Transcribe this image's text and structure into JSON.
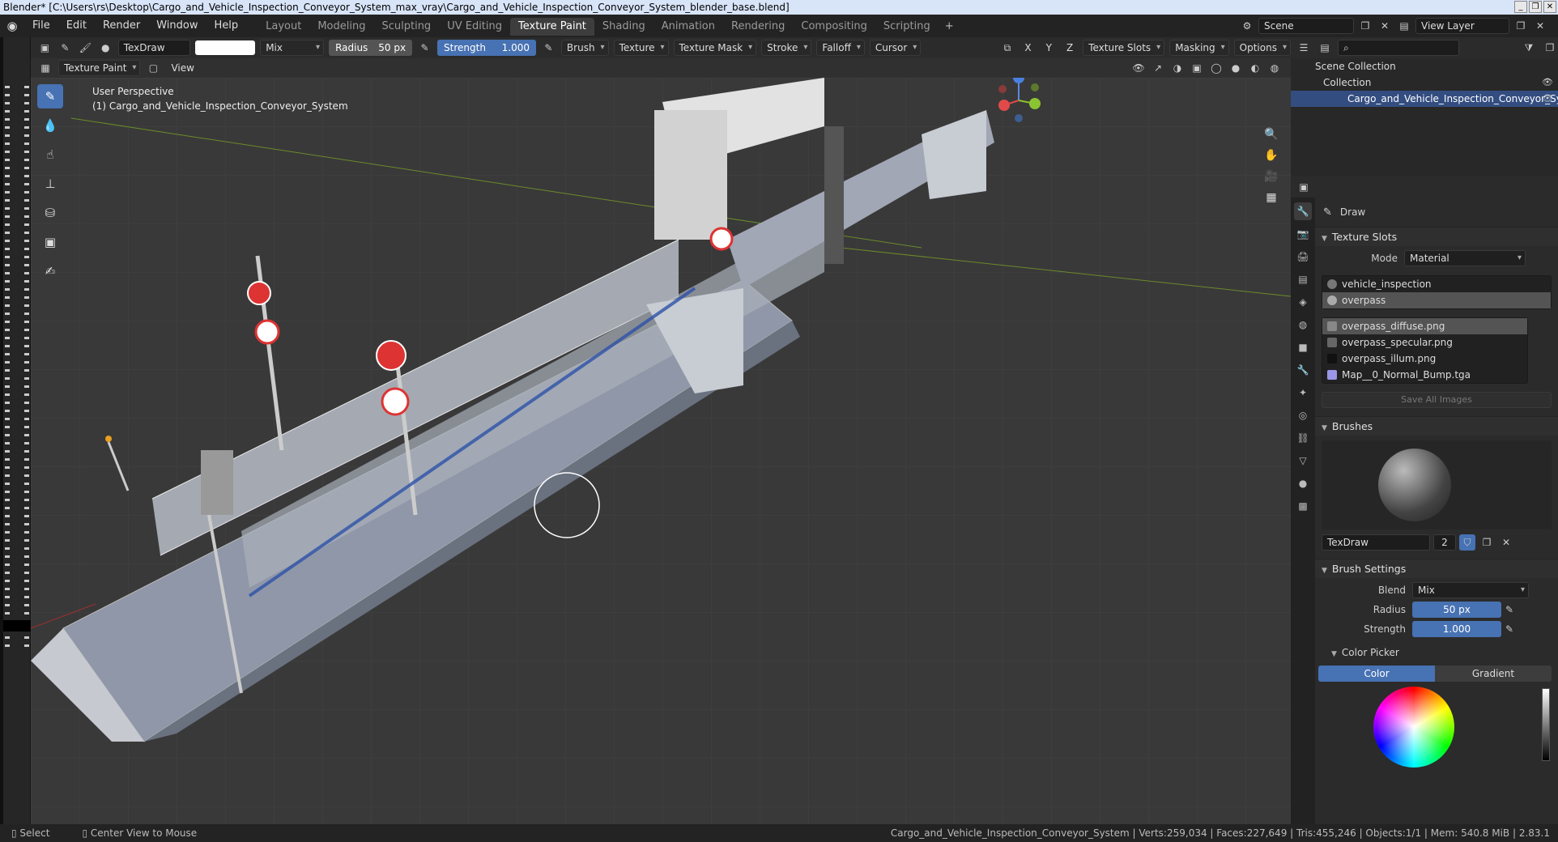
{
  "titlebar": {
    "text": "Blender* [C:\\Users\\rs\\Desktop\\Cargo_and_Vehicle_Inspection_Conveyor_System_max_vray\\Cargo_and_Vehicle_Inspection_Conveyor_System_blender_base.blend]"
  },
  "menu": {
    "items": [
      "File",
      "Edit",
      "Render",
      "Window",
      "Help"
    ]
  },
  "workspaces": {
    "tabs": [
      "Layout",
      "Modeling",
      "Sculpting",
      "UV Editing",
      "Texture Paint",
      "Shading",
      "Animation",
      "Rendering",
      "Compositing",
      "Scripting"
    ],
    "active": "Texture Paint"
  },
  "scene": {
    "name": "Scene",
    "view_layer": "View Layer"
  },
  "toolheader": {
    "brush_name": "TexDraw",
    "blend": "Mix",
    "radius_label": "Radius",
    "radius_value": "50 px",
    "strength_label": "Strength",
    "strength_value": "1.000",
    "menus": [
      "Brush",
      "Texture",
      "Texture Mask",
      "Stroke",
      "Falloff",
      "Cursor"
    ],
    "axes": [
      "X",
      "Y",
      "Z"
    ],
    "right_menus": [
      "Texture Slots",
      "Masking",
      "Options"
    ]
  },
  "viewheader": {
    "mode": "Texture Paint",
    "view": "View"
  },
  "viewport": {
    "perspective": "User Perspective",
    "object": "(1) Cargo_and_Vehicle_Inspection_Conveyor_System"
  },
  "outliner": {
    "scene_collection": "Scene Collection",
    "collection": "Collection",
    "object": "Cargo_and_Vehicle_Inspection_Conveyor_Sy"
  },
  "properties": {
    "tool_name": "Draw",
    "texture_slots_title": "Texture Slots",
    "mode_label": "Mode",
    "mode_value": "Material",
    "materials": [
      "vehicle_inspection",
      "overpass"
    ],
    "images": [
      "overpass_diffuse.png",
      "overpass_specular.png",
      "overpass_illum.png",
      "Map__0_Normal_Bump.tga"
    ],
    "save_all": "Save All Images",
    "brushes_title": "Brushes",
    "brush_name": "TexDraw",
    "brush_users": "2",
    "brush_settings_title": "Brush Settings",
    "blend_label": "Blend",
    "blend_value": "Mix",
    "radius_label": "Radius",
    "radius_value": "50 px",
    "strength_label": "Strength",
    "strength_value": "1.000",
    "color_picker_title": "Color Picker",
    "color_tab": "Color",
    "gradient_tab": "Gradient"
  },
  "statusbar": {
    "select": "Select",
    "center": "Center View to Mouse",
    "stats": "Cargo_and_Vehicle_Inspection_Conveyor_System | Verts:259,034 | Faces:227,649 | Tris:455,246 | Objects:1/1 | Mem: 540.8 MiB | 2.83.1"
  },
  "colors": {
    "accent": "#4772b3",
    "selected_row": "#334d80",
    "viewport_bg": "#3a3a3a"
  },
  "icons": [
    "blender-logo",
    "brush-icon",
    "eyedropper-icon",
    "eye-icon",
    "zoom-icon",
    "hand-icon",
    "camera-icon",
    "grid-icon",
    "plus-icon"
  ]
}
